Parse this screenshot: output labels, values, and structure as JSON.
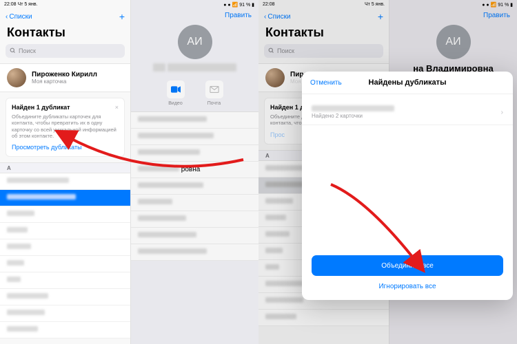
{
  "status": {
    "time": "22:08",
    "date": "Чт 5 янв.",
    "lists": "Списки",
    "battery": "91 %"
  },
  "header": {
    "back_label": "Списки",
    "title": "Контакты",
    "search_placeholder": "Поиск",
    "plus": "+",
    "edit": "Править"
  },
  "me": {
    "name": "Пироженко Кирилл",
    "sub": "Моя карточка",
    "initials": "АИ",
    "full_name_right": "на Владимировна"
  },
  "dup": {
    "title": "Найден 1 дубликат",
    "desc": "Объедините дубликаты карточек для контакта, чтобы превратить их в одну карточку со всей уникальной информацией об этом контакте.",
    "link": "Просмотреть дубликаты",
    "title2": "Найден 1 д"
  },
  "sections": {
    "a": "А"
  },
  "detail": {
    "video": "Видео",
    "mail": "Почта",
    "initials": "АИ",
    "ровна": "ровна"
  },
  "modal": {
    "cancel": "Отменить",
    "title": "Найдены дубликаты",
    "found_sub": "Найдено 2 карточки",
    "merge": "Объединить все",
    "ignore": "Игнорировать все"
  }
}
